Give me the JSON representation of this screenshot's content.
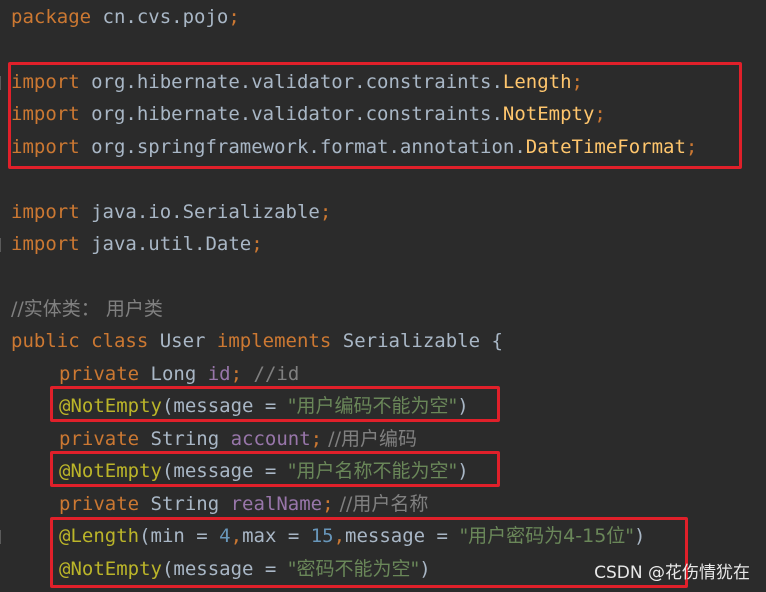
{
  "code": {
    "l1": {
      "kw": "package",
      "rest": " cn.cvs.pojo",
      "semi": ";"
    },
    "l2": {
      "kw": "import",
      "pkg": " org.hibernate.validator.constraints.",
      "cls": "Length",
      "semi": ";"
    },
    "l3": {
      "kw": "import",
      "pkg": " org.hibernate.validator.constraints.",
      "cls": "NotEmpty",
      "semi": ";"
    },
    "l4": {
      "kw": "import",
      "pkg": " org.springframework.format.annotation.",
      "cls": "DateTimeFormat",
      "semi": ";"
    },
    "l5": {
      "kw": "import",
      "pkg": " java.io.Serializable",
      "semi": ";"
    },
    "l6": {
      "kw": "import",
      "pkg": " java.util.Date",
      "semi": ";"
    },
    "l7": {
      "comment": "//实体类： 用户类"
    },
    "l8": {
      "kw1": "public class",
      "name": " User ",
      "kw2": "implements",
      "iface": " Serializable {"
    },
    "l9": {
      "kw": "private",
      "type": " Long ",
      "field": "id",
      "semi": ";",
      "comment": " //id"
    },
    "l10": {
      "anno": "@NotEmpty",
      "open": "(message = ",
      "str": "\"用户编码不能为空\"",
      "close": ")"
    },
    "l11": {
      "kw": "private",
      "type": " String ",
      "field": "account",
      "semi": ";",
      "comment": " //用户编码"
    },
    "l12": {
      "anno": "@NotEmpty",
      "open": "(message = ",
      "str": "\"用户名称不能为空\"",
      "close": ")"
    },
    "l13": {
      "kw": "private",
      "type": " String ",
      "field": "realName",
      "semi": ";",
      "comment": " //用户名称"
    },
    "l14": {
      "anno": "@Length",
      "p1": "(min = ",
      "n1": "4",
      "c1": ",",
      "p2": "max = ",
      "n2": "15",
      "c2": ",",
      "p3": "message = ",
      "str": "\"用户密码为4-15位\"",
      "close": ")"
    },
    "l15": {
      "anno": "@NotEmpty",
      "open": "(message = ",
      "str": "\"密码不能为空\"",
      "close": ")"
    }
  },
  "watermark": "CSDN @花伤情犹在",
  "colors": {
    "background": "#2b2b2b",
    "keyword": "#cc7832",
    "text": "#a9b7c6",
    "class": "#ffc66d",
    "field": "#9876aa",
    "string": "#6a8759",
    "number": "#6897bb",
    "annotation": "#bbb529",
    "comment": "#808080",
    "highlight_box": "#e0202a"
  }
}
